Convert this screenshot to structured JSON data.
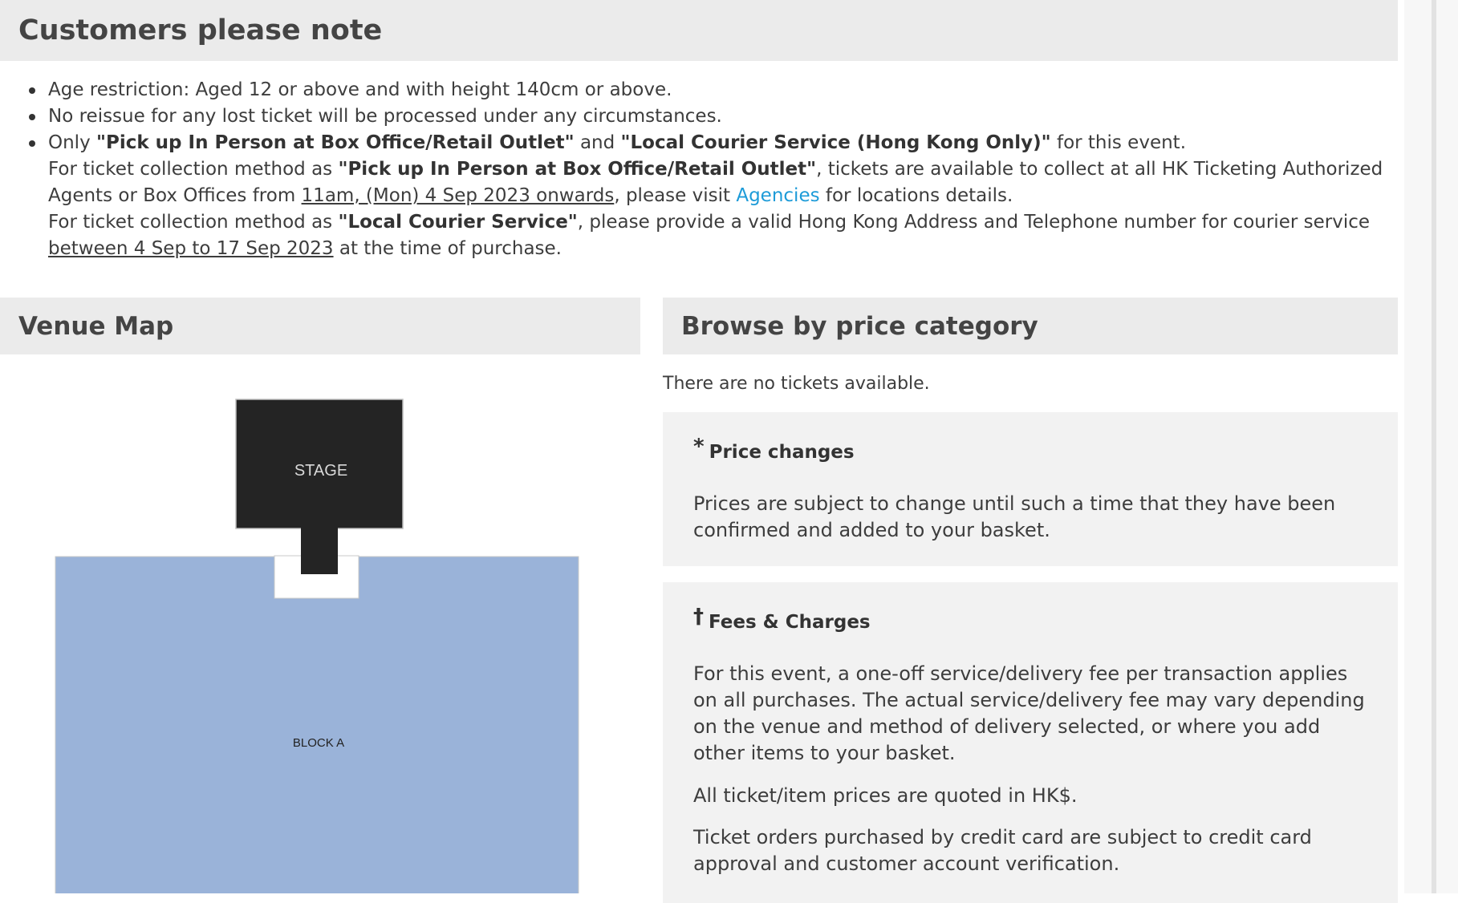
{
  "notes": {
    "title": "Customers please note",
    "bullet_1": "Age restriction: Aged 12 or above and with height 140cm or above.",
    "bullet_2": "No reissue for any lost ticket will be processed under any circumstances.",
    "bullet_3": {
      "prefix": "Only ",
      "method_pickup": "\"Pick up In Person at Box Office/Retail Outlet\"",
      "and": " and ",
      "method_courier": "\"Local Courier Service (Hong Kong Only)\"",
      "suffix": " for this event.",
      "pickup_intro": "For ticket collection method as ",
      "pickup_method": "\"Pick up In Person at Box Office/Retail Outlet\"",
      "pickup_text": ", tickets are available to collect at all HK Ticketing Authorized Agents or Box Offices from ",
      "pickup_date": "11am, (Mon) 4 Sep 2023 onwards",
      "pickup_visit": ", please visit ",
      "agencies_link": "Agencies",
      "pickup_end": " for locations details.",
      "courier_intro": "For ticket collection method as ",
      "courier_method": "\"Local Courier Service\"",
      "courier_text": ", please provide a valid Hong Kong Address and Telephone number for courier service ",
      "courier_dates": "between 4 Sep to 17 Sep 2023",
      "courier_end": " at the time of purchase."
    }
  },
  "venue": {
    "title": "Venue Map",
    "stage_label": "STAGE",
    "block_label": "BLOCK A",
    "colors": {
      "stage": "#242424",
      "block": "#9ab3d9"
    }
  },
  "price": {
    "title": "Browse by price category",
    "no_tickets": "There are no tickets available."
  },
  "price_changes": {
    "mark": "*",
    "title": "Price changes",
    "text": "Prices are subject to change until such a time that they have been confirmed and added to your basket."
  },
  "fees": {
    "mark": "†",
    "title": "Fees & Charges",
    "text_1": "For this event, a one-off service/delivery fee per transaction applies on all purchases. The actual service/delivery fee may vary depending on the venue and method of delivery selected, or where you add other items to your basket.",
    "text_2": "All ticket/item prices are quoted in HK$.",
    "text_3": "Ticket orders purchased by credit card are subject to credit card approval and customer account verification."
  },
  "colors": {
    "link": "#1d9bd8",
    "header_bg": "#ebebeb",
    "box_bg": "#f2f2f2"
  }
}
